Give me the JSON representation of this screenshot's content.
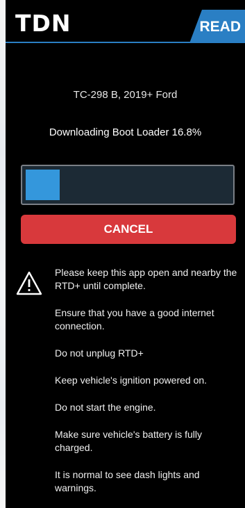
{
  "header": {
    "logo_text": "TDN",
    "mode_label": "READ"
  },
  "main": {
    "vehicle": "TC-298 B, 2019+ Ford",
    "status": "Downloading Boot Loader 16.8%",
    "progress_fraction": 0.168,
    "cancel_label": "CANCEL"
  },
  "icons": {
    "warning": "warning-triangle-icon"
  },
  "instructions": [
    "Please keep this app open and nearby the RTD+ until complete.",
    "Ensure that you have a good internet connection.",
    "Do not unplug RTD+",
    "Keep vehicle's ignition powered on.",
    "Do not start the engine.",
    "Make sure vehicle's battery is fully charged.",
    "It is normal to see dash lights and warnings."
  ],
  "colors": {
    "accent": "#2a7fc4",
    "progress_fill": "#3497dc",
    "cancel_button": "#d8393c",
    "background": "#000000"
  }
}
